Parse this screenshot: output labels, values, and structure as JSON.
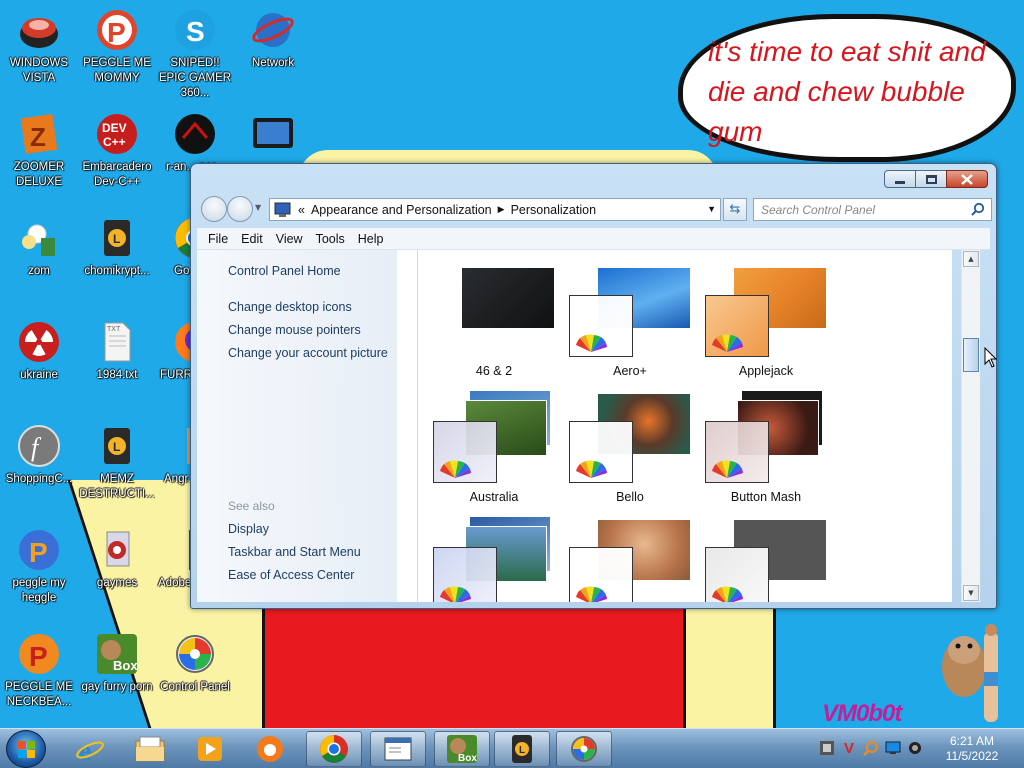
{
  "wallpaper": {
    "bubble_text": "it's time to eat shit and die and chew bubble gum",
    "signature": "VM0b0t"
  },
  "desktop_icons": [
    {
      "label": "WINDOWS VISTA",
      "icon": "windows-vista-icon"
    },
    {
      "label": "ZOOMER DELUXE",
      "icon": "zoomer-deluxe-icon"
    },
    {
      "label": "zom",
      "icon": "zom-icon"
    },
    {
      "label": "ukraine",
      "icon": "radiation-icon"
    },
    {
      "label": "ShoppingC...",
      "icon": "flash-icon"
    },
    {
      "label": "peggle my heggle",
      "icon": "peggle-icon"
    },
    {
      "label": "PEGGLE ME NECKBEA...",
      "icon": "peggle-icon"
    },
    {
      "label": "PEGGLE ME MOMMY",
      "icon": "peggle-icon"
    },
    {
      "label": "Embarcadero Dev-C++",
      "icon": "dev-cpp-icon"
    },
    {
      "label": "chomikrypt...",
      "icon": "chomikrypt-icon"
    },
    {
      "label": "1984.txt",
      "icon": "text-file-icon"
    },
    {
      "label": "MEMZ DESTRUCTI...",
      "icon": "memz-icon"
    },
    {
      "label": "gaymes",
      "icon": "gaymes-icon"
    },
    {
      "label": "gay furry porn",
      "icon": "box-game-icon"
    },
    {
      "label": "SNIPED!! EPIC GAMER 360...",
      "icon": "skype-icon"
    },
    {
      "label": "r-an... par...",
      "icon": "r-app-icon"
    },
    {
      "label": "Go... Chr...",
      "icon": "chrome-icon"
    },
    {
      "label": "FURR...",
      "icon": "firefox-icon"
    },
    {
      "label": "Angr... Sea...",
      "icon": "angry-icon"
    },
    {
      "label": "Adobe...",
      "icon": "adobe-icon"
    },
    {
      "label": "Control Panel",
      "icon": "control-panel-icon"
    },
    {
      "label": "Network",
      "icon": "network-icon"
    }
  ],
  "window": {
    "address": {
      "lead": "«",
      "crumb1": "Appearance and Personalization",
      "crumb2": "Personalization"
    },
    "search_placeholder": "Search Control Panel",
    "menu": [
      "File",
      "Edit",
      "View",
      "Tools",
      "Help"
    ],
    "sidebar": {
      "home": "Control Panel Home",
      "tasks": [
        "Change desktop icons",
        "Change mouse pointers",
        "Change your account picture"
      ],
      "see_also_title": "See also",
      "see_also": [
        "Display",
        "Taskbar and Start Menu",
        "Ease of Access Center"
      ]
    },
    "themes": [
      {
        "name": "46 & 2"
      },
      {
        "name": "Aero+"
      },
      {
        "name": "Applejack"
      },
      {
        "name": "Australia"
      },
      {
        "name": "Bello"
      },
      {
        "name": "Button Mash"
      },
      {
        "name": ""
      },
      {
        "name": ""
      },
      {
        "name": ""
      }
    ]
  },
  "taskbar": {
    "pinned": [
      "internet-explorer-icon",
      "file-explorer-icon",
      "media-player-icon",
      "uc-browser-icon",
      "chrome-icon",
      "notepad-window-icon",
      "box-game-icon",
      "chomikrypt-icon",
      "control-panel-icon"
    ],
    "tray": [
      "tray-app-icon",
      "tray-v-icon",
      "tray-search-icon",
      "tray-network-icon",
      "tray-volume-icon"
    ],
    "time": "6:21 AM",
    "date": "11/5/2022"
  }
}
